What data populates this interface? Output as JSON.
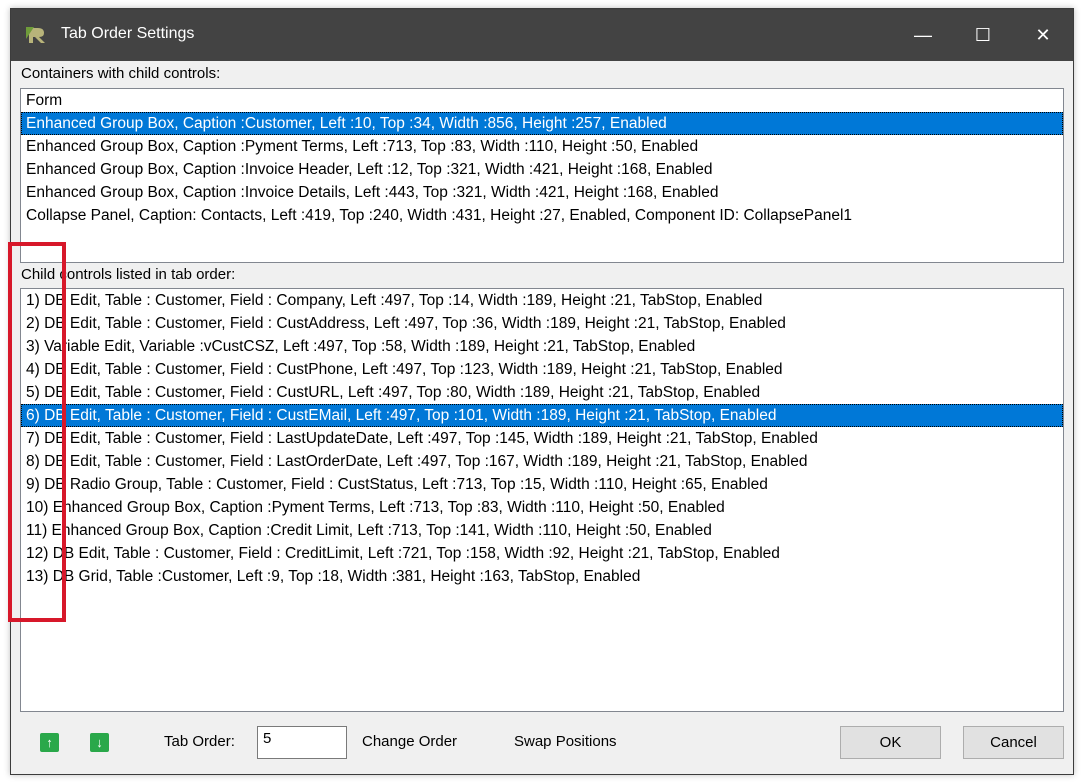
{
  "window": {
    "title": "Tab Order Settings",
    "minimize_glyph": "—",
    "maximize_glyph": "☐",
    "close_glyph": "✕"
  },
  "containers": {
    "label": "Containers with child controls:",
    "selected_index": 1,
    "items": [
      "Form",
      "Enhanced Group Box, Caption :Customer, Left :10, Top :34, Width :856, Height :257, Enabled",
      "Enhanced Group Box, Caption :Pyment Terms, Left :713, Top :83, Width :110, Height :50, Enabled",
      "Enhanced Group Box, Caption :Invoice Header, Left :12, Top :321, Width :421, Height :168, Enabled",
      "Enhanced Group Box, Caption :Invoice Details, Left :443, Top :321, Width :421, Height :168, Enabled",
      "Collapse Panel, Caption: Contacts, Left :419, Top :240, Width :431, Height :27, Enabled, Component ID: CollapsePanel1"
    ]
  },
  "children": {
    "label": "Child controls listed in tab order:",
    "selected_index": 5,
    "items": [
      "1) DB Edit, Table : Customer, Field : Company, Left :497, Top :14, Width :189, Height :21, TabStop, Enabled",
      "2) DB Edit, Table : Customer, Field : CustAddress, Left :497, Top :36, Width :189, Height :21, TabStop, Enabled",
      "3) Variable Edit, Variable :vCustCSZ, Left :497, Top :58, Width :189, Height :21, TabStop, Enabled",
      "4) DB Edit, Table : Customer, Field : CustPhone, Left :497, Top :123, Width :189, Height :21, TabStop, Enabled",
      "5) DB Edit, Table : Customer, Field : CustURL, Left :497, Top :80, Width :189, Height :21, TabStop, Enabled",
      "6) DB Edit, Table : Customer, Field : CustEMail, Left :497, Top :101, Width :189, Height :21, TabStop, Enabled",
      "7) DB Edit, Table : Customer, Field : LastUpdateDate, Left :497, Top :145, Width :189, Height :21, TabStop, Enabled",
      "8) DB Edit, Table : Customer, Field : LastOrderDate, Left :497, Top :167, Width :189, Height :21, TabStop, Enabled",
      "9) DB Radio Group, Table : Customer, Field : CustStatus, Left :713, Top :15, Width :110, Height :65, Enabled",
      "10) Enhanced Group Box, Caption :Pyment Terms, Left :713, Top :83, Width :110, Height :50, Enabled",
      "11) Enhanced Group Box, Caption :Credit Limit, Left :713, Top :141, Width :110, Height :50, Enabled",
      "12) DB Edit, Table : Customer, Field : CreditLimit, Left :721, Top :158, Width :92, Height :21, TabStop, Enabled",
      "13) DB Grid, Table :Customer, Left :9, Top :18, Width :381, Height :163, TabStop, Enabled"
    ]
  },
  "bottom": {
    "tab_order_label": "Tab Order:",
    "tab_order_value": "5",
    "change_order": "Change Order",
    "swap_positions": "Swap Positions",
    "ok": "OK",
    "cancel": "Cancel",
    "up_arrow_glyph": "↑",
    "down_arrow_glyph": "↓"
  },
  "colors": {
    "titlebar": "#434343",
    "selection": "#0078d7",
    "highlight_box": "#d7182a",
    "arrow_button": "#2aa84a"
  }
}
